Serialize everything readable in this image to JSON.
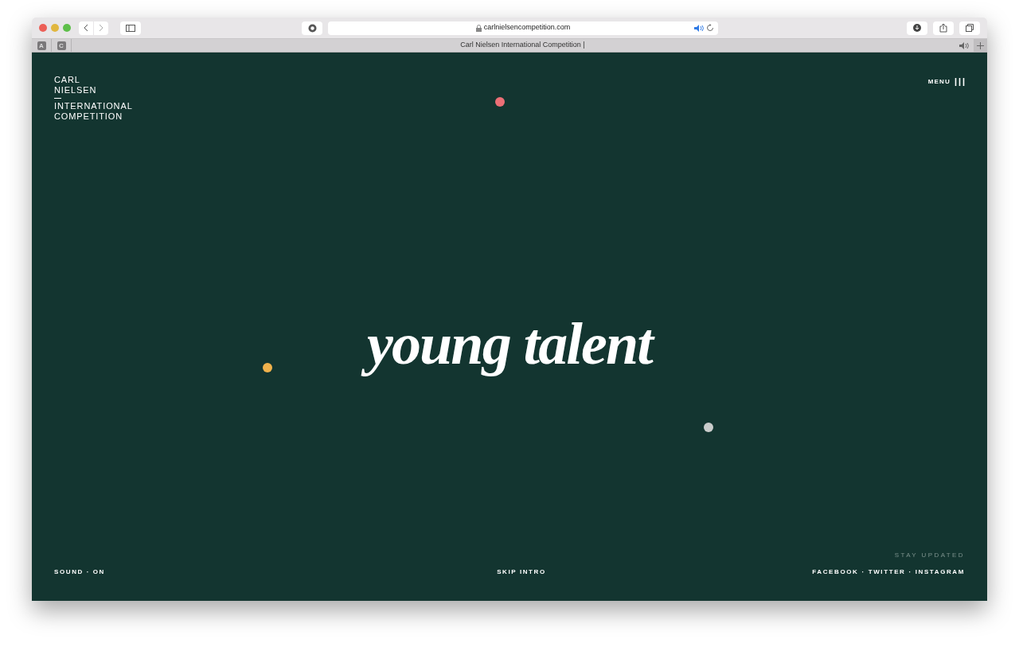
{
  "browser": {
    "url": "carlnielsencompetition.com",
    "pinned_tabs": [
      "A",
      "C"
    ],
    "tab": {
      "title": "Carl Nielsen International Competition |",
      "selected": true
    }
  },
  "logo": {
    "lines_top": [
      "CARL",
      "NIELSEN"
    ],
    "lines_bottom": [
      "INTERNATIONAL",
      "COMPETITION"
    ]
  },
  "menu": {
    "label": "MENU"
  },
  "headline": "young talent",
  "dots": [
    {
      "color": "#ec6f76"
    },
    {
      "color": "#f0b24c"
    },
    {
      "color": "#c9cccb"
    }
  ],
  "footer": {
    "sound": "SOUND · ON",
    "skip": "SKIP INTRO",
    "stay_updated": "STAY UPDATED",
    "social": [
      "FACEBOOK",
      "TWITTER",
      "INSTAGRAM"
    ],
    "separator": "·"
  }
}
